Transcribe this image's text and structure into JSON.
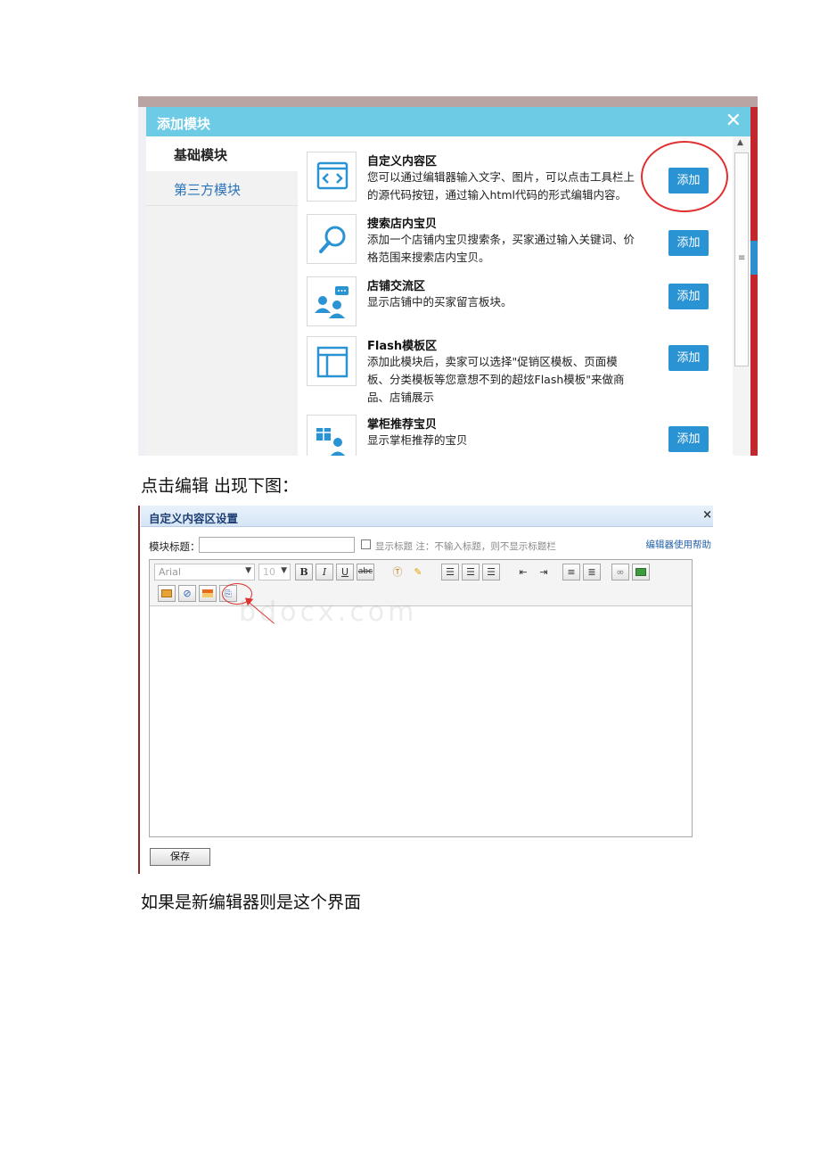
{
  "dialog": {
    "title": "添加模块",
    "close_icon": "close-icon",
    "sidebar": {
      "tabs": [
        {
          "label": "基础模块",
          "active": true
        },
        {
          "label": "第三方模块",
          "active": false
        }
      ]
    },
    "add_label": "添加",
    "modules": [
      {
        "name": "自定义内容区",
        "icon": "code-icon",
        "desc_lines": [
          "您可以通过编辑器输入文字、图片，可以点击工具栏上",
          "的源代码按钮，通过输入html代码的形式编辑内容。"
        ]
      },
      {
        "name": "搜索店内宝贝",
        "icon": "search-icon",
        "desc_lines": [
          "添加一个店铺内宝贝搜索条，买家通过输入关键词、价",
          "格范围来搜索店内宝贝。"
        ]
      },
      {
        "name": "店铺交流区",
        "icon": "chat-users-icon",
        "desc_lines": [
          "显示店铺中的买家留言板块。"
        ]
      },
      {
        "name": "Flash模板区",
        "icon": "layout-icon",
        "desc_lines": [
          "添加此模块后，卖家可以选择\"促销区模板、页面模",
          "板、分类模板等您意想不到的超炫Flash模板\"来做商",
          "品、店铺展示"
        ]
      },
      {
        "name": "掌柜推荐宝贝",
        "icon": "gift-user-icon",
        "desc_lines": [
          "显示掌柜推荐的宝贝"
        ]
      }
    ],
    "colors": {
      "titlebar": "#6ecbe6",
      "add_button": "#2a93d4",
      "highlight_circle": "#e03030"
    }
  },
  "captions": {
    "first": "点击编辑 出现下图：",
    "second": "如果是新编辑器则是这个界面"
  },
  "editor": {
    "title": "自定义内容区设置",
    "close_label": "×",
    "module_title_label": "模块标题：",
    "module_title_value": "",
    "show_title_label": "显示标题 注：不输入标题，则不显示标题栏",
    "show_title_checked": false,
    "help_link": "编辑器使用帮助",
    "font_family": "Arial",
    "font_size": "10",
    "toolbar_row1": [
      "bold-button",
      "italic-button",
      "underline-button",
      "strikethrough-button",
      "text-color-button",
      "highlight-button",
      "align-left-button",
      "align-center-button",
      "align-right-button",
      "outdent-button",
      "indent-button",
      "bullet-list-button",
      "numbered-list-button",
      "link-button",
      "image-button"
    ],
    "toolbar_row2": [
      "insert-media-button",
      "flash-button",
      "table-button",
      "source-code-button"
    ],
    "bold_label": "B",
    "italic_label": "I",
    "underline_label": "U",
    "strike_label": "abc",
    "save_label": "保存",
    "watermark": "bdocx.com"
  }
}
